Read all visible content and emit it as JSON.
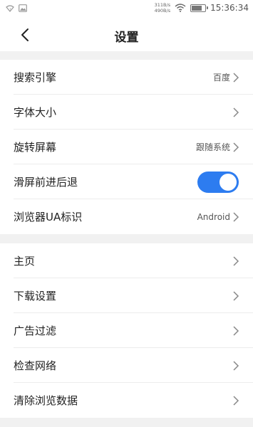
{
  "status_bar": {
    "speed_up": "311B/s",
    "speed_down": "490B/s",
    "time": "15:36:34",
    "battery_level": 0.68
  },
  "header": {
    "title": "设置"
  },
  "section1": [
    {
      "label": "搜索引擎",
      "value": "百度",
      "control": "chevron"
    },
    {
      "label": "字体大小",
      "value": "",
      "control": "chevron"
    },
    {
      "label": "旋转屏幕",
      "value": "跟随系统",
      "control": "chevron"
    },
    {
      "label": "滑屏前进后退",
      "value": "",
      "control": "toggle",
      "toggle_on": true
    },
    {
      "label": "浏览器UA标识",
      "value": "Android",
      "control": "chevron"
    }
  ],
  "section2": [
    {
      "label": "主页",
      "control": "chevron"
    },
    {
      "label": "下载设置",
      "control": "chevron"
    },
    {
      "label": "广告过滤",
      "control": "chevron"
    },
    {
      "label": "检查网络",
      "control": "chevron"
    },
    {
      "label": "清除浏览数据",
      "control": "chevron"
    }
  ],
  "colors": {
    "accent": "#2d7cf0",
    "section_gap": "#f1f1f1"
  }
}
